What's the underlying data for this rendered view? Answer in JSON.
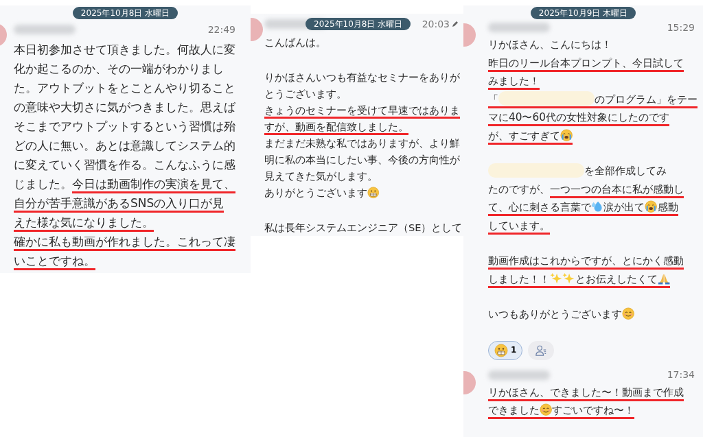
{
  "panels": [
    {
      "date": "2025年10月8日 水曜日",
      "date_overlaps_header": false,
      "messages": [
        {
          "time": "22:49",
          "edited": false,
          "blocks": [
            {
              "lines": [
                {
                  "segments": [
                    {
                      "kind": "text",
                      "text": "本日初参加させて頂きました。何故人に変",
                      "underlined": false
                    }
                  ]
                },
                {
                  "segments": [
                    {
                      "kind": "text",
                      "text": "化か起こるのか、その一端がわかりまし",
                      "underlined": false
                    }
                  ]
                },
                {
                  "segments": [
                    {
                      "kind": "text",
                      "text": "た。アウトブットをとことんやり切ること",
                      "underlined": false
                    }
                  ]
                },
                {
                  "segments": [
                    {
                      "kind": "text",
                      "text": "の意味や大切さに気がつきました。思えば",
                      "underlined": false
                    }
                  ]
                },
                {
                  "segments": [
                    {
                      "kind": "text",
                      "text": "そこまでアウトプットするという習慣は殆",
                      "underlined": false
                    }
                  ]
                },
                {
                  "segments": [
                    {
                      "kind": "text",
                      "text": "どの人に無い。あとは意識してシステム的",
                      "underlined": false
                    }
                  ]
                },
                {
                  "segments": [
                    {
                      "kind": "text",
                      "text": "に変えていく習慣を作る。こんなふうに感",
                      "underlined": false
                    }
                  ]
                },
                {
                  "segments": [
                    {
                      "kind": "text",
                      "text": "じました。",
                      "underlined": false
                    },
                    {
                      "kind": "text",
                      "text": "今日は動画制作の実演を見て、",
                      "underlined": true
                    }
                  ]
                },
                {
                  "segments": [
                    {
                      "kind": "text",
                      "text": "自分が苦手意識があるSNSの入り口が見",
                      "underlined": true
                    }
                  ]
                },
                {
                  "segments": [
                    {
                      "kind": "text",
                      "text": "えた様な気になりました。",
                      "underlined": true
                    }
                  ]
                },
                {
                  "segments": [
                    {
                      "kind": "text",
                      "text": "確かに私も動画が作れました。",
                      "underlined": true
                    },
                    {
                      "kind": "text",
                      "text": "これって凄",
                      "underlined": true
                    }
                  ]
                },
                {
                  "segments": [
                    {
                      "kind": "text",
                      "text": "いことですね。",
                      "underlined": true
                    }
                  ]
                }
              ]
            }
          ]
        }
      ]
    },
    {
      "date": "2025年10月8日 水曜日",
      "date_overlaps_header": true,
      "messages": [
        {
          "time": "20:03",
          "edited": true,
          "blocks": [
            {
              "lines": [
                {
                  "segments": [
                    {
                      "kind": "text",
                      "text": "こんばんは。",
                      "underlined": false
                    }
                  ]
                }
              ]
            },
            {
              "lines": [
                {
                  "segments": [
                    {
                      "kind": "text",
                      "text": "りかほさんいつも有益なセミナーをありが",
                      "underlined": false
                    }
                  ]
                },
                {
                  "segments": [
                    {
                      "kind": "text",
                      "text": "とうございます。",
                      "underlined": false
                    }
                  ]
                },
                {
                  "segments": [
                    {
                      "kind": "text",
                      "text": "きょうのセミナーを受けて早速ではありま",
                      "underlined": true
                    }
                  ]
                },
                {
                  "segments": [
                    {
                      "kind": "text",
                      "text": "すが、動画を配信致しました。",
                      "underlined": true
                    }
                  ]
                },
                {
                  "segments": [
                    {
                      "kind": "text",
                      "text": "まだまだ未熟な私ではありますが、より鮮",
                      "underlined": false
                    }
                  ]
                },
                {
                  "segments": [
                    {
                      "kind": "text",
                      "text": "明に私の本当にしたい事、今後の方向性が",
                      "underlined": false
                    }
                  ]
                },
                {
                  "segments": [
                    {
                      "kind": "text",
                      "text": "見えてきた気がします。",
                      "underlined": false
                    }
                  ]
                },
                {
                  "segments": [
                    {
                      "kind": "text",
                      "text": "ありがとうございます",
                      "underlined": false
                    },
                    {
                      "kind": "grimace",
                      "underlined": false
                    }
                  ]
                }
              ]
            },
            {
              "lines": [
                {
                  "segments": [
                    {
                      "kind": "text",
                      "text": "私は長年システムエンジニア（SE）として",
                      "underlined": false
                    }
                  ]
                }
              ]
            }
          ]
        }
      ]
    },
    {
      "date": "2025年10月9日 木曜日",
      "date_overlaps_header": false,
      "messages": [
        {
          "time": "15:29",
          "edited": false,
          "blocks": [
            {
              "lines": [
                {
                  "segments": [
                    {
                      "kind": "text",
                      "text": "リかほさん、こんにちは！",
                      "underlined": false
                    }
                  ]
                },
                {
                  "segments": [
                    {
                      "kind": "text",
                      "text": "昨日のリール台本プロンプト、今日試して",
                      "underlined": true
                    }
                  ]
                },
                {
                  "segments": [
                    {
                      "kind": "text",
                      "text": "みました！",
                      "underlined": true
                    }
                  ]
                },
                {
                  "segments": [
                    {
                      "kind": "text",
                      "text": "「",
                      "underlined": true
                    },
                    {
                      "kind": "redaction",
                      "underlined": true
                    },
                    {
                      "kind": "text",
                      "text": "のプログラム」をテー",
                      "underlined": true
                    }
                  ]
                },
                {
                  "segments": [
                    {
                      "kind": "text",
                      "text": "マに40〜60代の女性対象にしたのです",
                      "underlined": true
                    }
                  ]
                },
                {
                  "segments": [
                    {
                      "kind": "text",
                      "text": "が、すごすぎて",
                      "underlined": true
                    },
                    {
                      "kind": "cry",
                      "underlined": true
                    }
                  ]
                }
              ]
            },
            {
              "lines": [
                {
                  "segments": [
                    {
                      "kind": "redaction",
                      "underlined": false
                    },
                    {
                      "kind": "text",
                      "text": "を全部作成してみ",
                      "underlined": false
                    }
                  ]
                },
                {
                  "segments": [
                    {
                      "kind": "text",
                      "text": "たのですが、",
                      "underlined": false
                    },
                    {
                      "kind": "text",
                      "text": "一つ一つの台本に私が感動し",
                      "underlined": true
                    }
                  ]
                },
                {
                  "segments": [
                    {
                      "kind": "text",
                      "text": "て、心に刺さる言葉で",
                      "underlined": true
                    },
                    {
                      "kind": "drops",
                      "underlined": true
                    },
                    {
                      "kind": "text",
                      "text": "涙が出て",
                      "underlined": true
                    },
                    {
                      "kind": "cry",
                      "underlined": true
                    },
                    {
                      "kind": "text",
                      "text": "感動",
                      "underlined": true
                    }
                  ]
                },
                {
                  "segments": [
                    {
                      "kind": "text",
                      "text": "しています。",
                      "underlined": true
                    }
                  ]
                }
              ]
            },
            {
              "lines": [
                {
                  "segments": [
                    {
                      "kind": "text",
                      "text": "動画作成はこれからですが、とにかく感動",
                      "underlined": true
                    }
                  ]
                },
                {
                  "segments": [
                    {
                      "kind": "text",
                      "text": "しました！！",
                      "underlined": true
                    },
                    {
                      "kind": "sparkles",
                      "underlined": true
                    },
                    {
                      "kind": "sparkles",
                      "underlined": true
                    },
                    {
                      "kind": "text",
                      "text": "とお伝えしたくて",
                      "underlined": true
                    },
                    {
                      "kind": "pray",
                      "underlined": true
                    }
                  ]
                }
              ]
            },
            {
              "lines": [
                {
                  "segments": [
                    {
                      "kind": "text",
                      "text": "いつもありがとうございます",
                      "underlined": false
                    },
                    {
                      "kind": "smile",
                      "underlined": false
                    }
                  ]
                }
              ]
            }
          ],
          "reactions": [
            {
              "kind": "grimace",
              "count": "1",
              "selected": true
            }
          ],
          "add_reaction": true
        },
        {
          "time": "17:34",
          "edited": false,
          "blocks": [
            {
              "lines": [
                {
                  "segments": [
                    {
                      "kind": "text",
                      "text": "リかほさん、できました〜！動画まで作成",
                      "underlined": true
                    }
                  ]
                },
                {
                  "segments": [
                    {
                      "kind": "text",
                      "text": "できました",
                      "underlined": true
                    },
                    {
                      "kind": "smile",
                      "underlined": true
                    },
                    {
                      "kind": "text",
                      "text": "すごいですね〜！",
                      "underlined": true
                    }
                  ]
                }
              ]
            }
          ]
        }
      ]
    }
  ]
}
